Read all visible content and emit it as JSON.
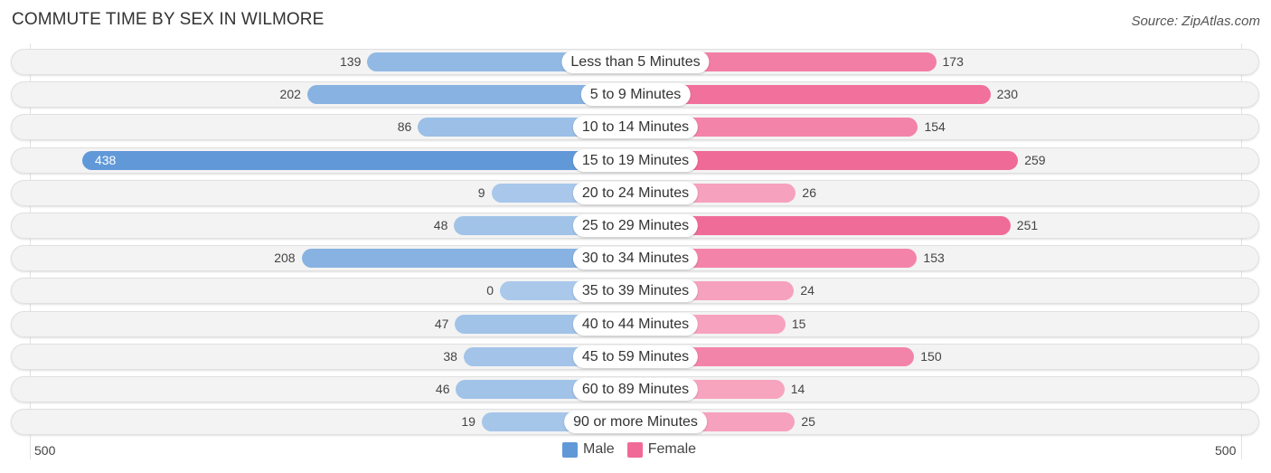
{
  "header": {
    "title": "COMMUTE TIME BY SEX IN WILMORE",
    "source": "Source: ZipAtlas.com"
  },
  "colors": {
    "male_strong": "#6199d8",
    "male_light": "#a9c8ea",
    "female_strong": "#f06a97",
    "female_light": "#f7a7c1"
  },
  "chart_data": {
    "type": "bar",
    "orientation": "horizontal-diverging",
    "title": "COMMUTE TIME BY SEX IN WILMORE",
    "categories": [
      "Less than 5 Minutes",
      "5 to 9 Minutes",
      "10 to 14 Minutes",
      "15 to 19 Minutes",
      "20 to 24 Minutes",
      "25 to 29 Minutes",
      "30 to 34 Minutes",
      "35 to 39 Minutes",
      "40 to 44 Minutes",
      "45 to 59 Minutes",
      "60 to 89 Minutes",
      "90 or more Minutes"
    ],
    "series": [
      {
        "name": "Male",
        "values": [
          139,
          202,
          86,
          438,
          9,
          48,
          208,
          0,
          47,
          38,
          46,
          19
        ]
      },
      {
        "name": "Female",
        "values": [
          173,
          230,
          154,
          259,
          26,
          251,
          153,
          24,
          15,
          150,
          14,
          25
        ]
      }
    ],
    "axis": {
      "left_label": "500",
      "right_label": "500",
      "range": [
        0,
        500
      ]
    },
    "legend": [
      "Male",
      "Female"
    ],
    "legend_position": "bottom-center",
    "grid": false
  }
}
